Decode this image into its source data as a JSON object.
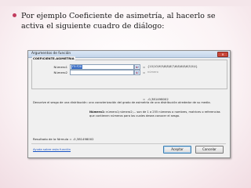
{
  "slide": {
    "bullet_text": "Por ejemplo Coeficiente de asimetría, al hacerlo se activa el siguiente cuadro de diálogo:",
    "accent_color": "#c23d5f"
  },
  "dialog": {
    "title": "Argumentos de función",
    "close_label": "✕",
    "function_name": "COEFICIENTE.ASIMETRIA",
    "args": [
      {
        "label": "Número1",
        "value": "F5:F20",
        "equals": "=",
        "result": "{10\\10\\9\\9\\8\\8\\8\\7\\6\\6\\6\\6\\6\\5\\5\\4}"
      },
      {
        "label": "Número2",
        "value": "",
        "equals": "=",
        "result": "número"
      }
    ],
    "computed_equals": "=",
    "computed_value": "-0,381498002",
    "description": "Devuelve el sesgo de una distribución: una caracterización del grado de asimetría de una distribución alrededor de su media.",
    "number_desc_label": "Número1:",
    "number_desc_text": "número1;número2;... son de 1 a 255 números o nombres, matrices o referencias que contienen números para los cuales desea conocer el sesgo.",
    "formula_result_label": "Resultado de la fórmula =",
    "formula_result_value": "-0,381498002",
    "help_link": "Ayuda sobre esta función",
    "ok_label": "Aceptar",
    "cancel_label": "Cancelar"
  }
}
